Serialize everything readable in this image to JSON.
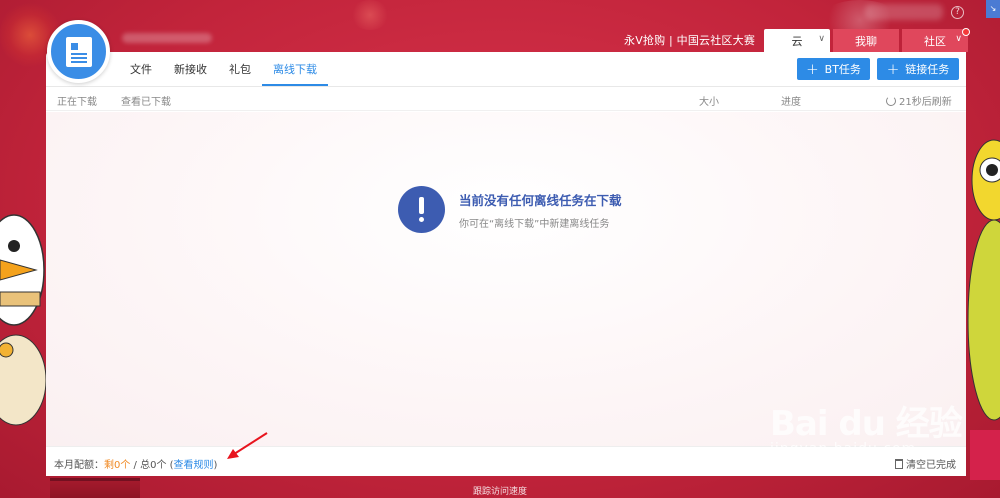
{
  "window": {
    "title": "永V抢购 | 中国云社区大赛",
    "help_label": "?",
    "corner_label": "↘"
  },
  "top_tabs": [
    {
      "label": "云"
    },
    {
      "label": "我聊"
    },
    {
      "label": "社区"
    }
  ],
  "nav": {
    "items": [
      {
        "label": "文件"
      },
      {
        "label": "新接收"
      },
      {
        "label": "礼包"
      },
      {
        "label": "离线下载"
      }
    ],
    "active_index": 3
  },
  "actions": {
    "bt_task": "BT任务",
    "link_task": "链接任务"
  },
  "subheader": {
    "downloading": "正在下载",
    "view_downloaded": "查看已下载",
    "size": "大小",
    "progress": "进度",
    "refresh": "21秒后刷新"
  },
  "empty_state": {
    "title": "当前没有任何离线任务在下载",
    "subtitle": "你可在“离线下载”中新建离线任务"
  },
  "footer": {
    "quota_prefix": "本月配额：",
    "quota_remain": "剩0个",
    "quota_total": " / 总0个 (",
    "quota_rule": "查看规则",
    "quota_suffix": ")",
    "clear_done": "清空已完成"
  },
  "status_bar": {
    "text": "跟踪访问速度"
  },
  "watermark": {
    "main": "Bai du 经验",
    "sub": "jingyan.baidu.com"
  },
  "colors": {
    "accent": "#2d8be6",
    "brand_bg": "#c8283f",
    "alert": "#3d5cb1",
    "quota_remain": "#f08a24"
  },
  "icons": {
    "avatar": "document-icon",
    "refresh": "refresh-icon",
    "alert": "exclamation-icon",
    "clear": "trash-icon"
  }
}
